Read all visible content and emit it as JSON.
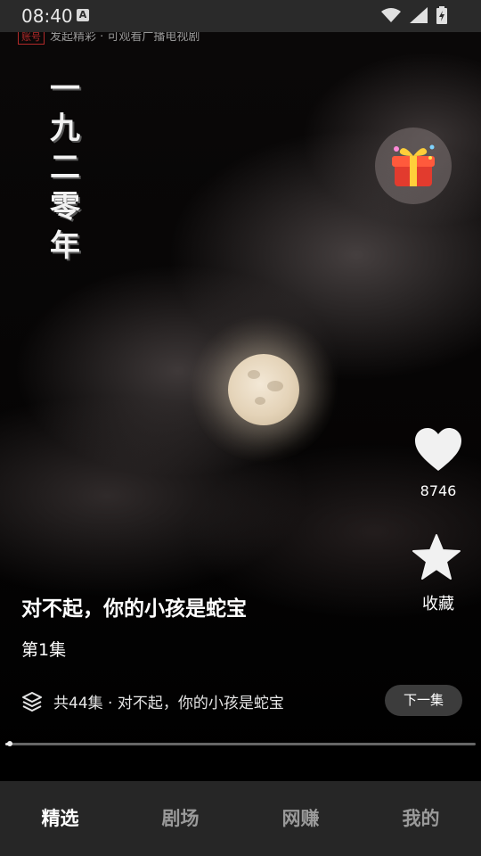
{
  "status_bar": {
    "time": "08:40",
    "a_icon": "A"
  },
  "video": {
    "watermark_badge": "账号",
    "watermark_text": "发起精彩 · 可观看广播电视剧",
    "vertical_title": "一九二零年"
  },
  "actions": {
    "like_count": "8746",
    "favorite_label": "收藏"
  },
  "info": {
    "drama_title": "对不起，你的小孩是蛇宝",
    "episode": "第1集",
    "series_text": "共44集 · 对不起，你的小孩是蛇宝",
    "next_label": "下一集"
  },
  "playback": {
    "progress": 0.01
  },
  "tabs": [
    {
      "label": "精选",
      "active": true
    },
    {
      "label": "剧场",
      "active": false
    },
    {
      "label": "网赚",
      "active": false
    },
    {
      "label": "我的",
      "active": false
    }
  ],
  "icons": [
    "wifi-icon",
    "signal-icon",
    "battery-icon",
    "gift-icon",
    "heart-icon",
    "star-icon",
    "layers-icon"
  ]
}
